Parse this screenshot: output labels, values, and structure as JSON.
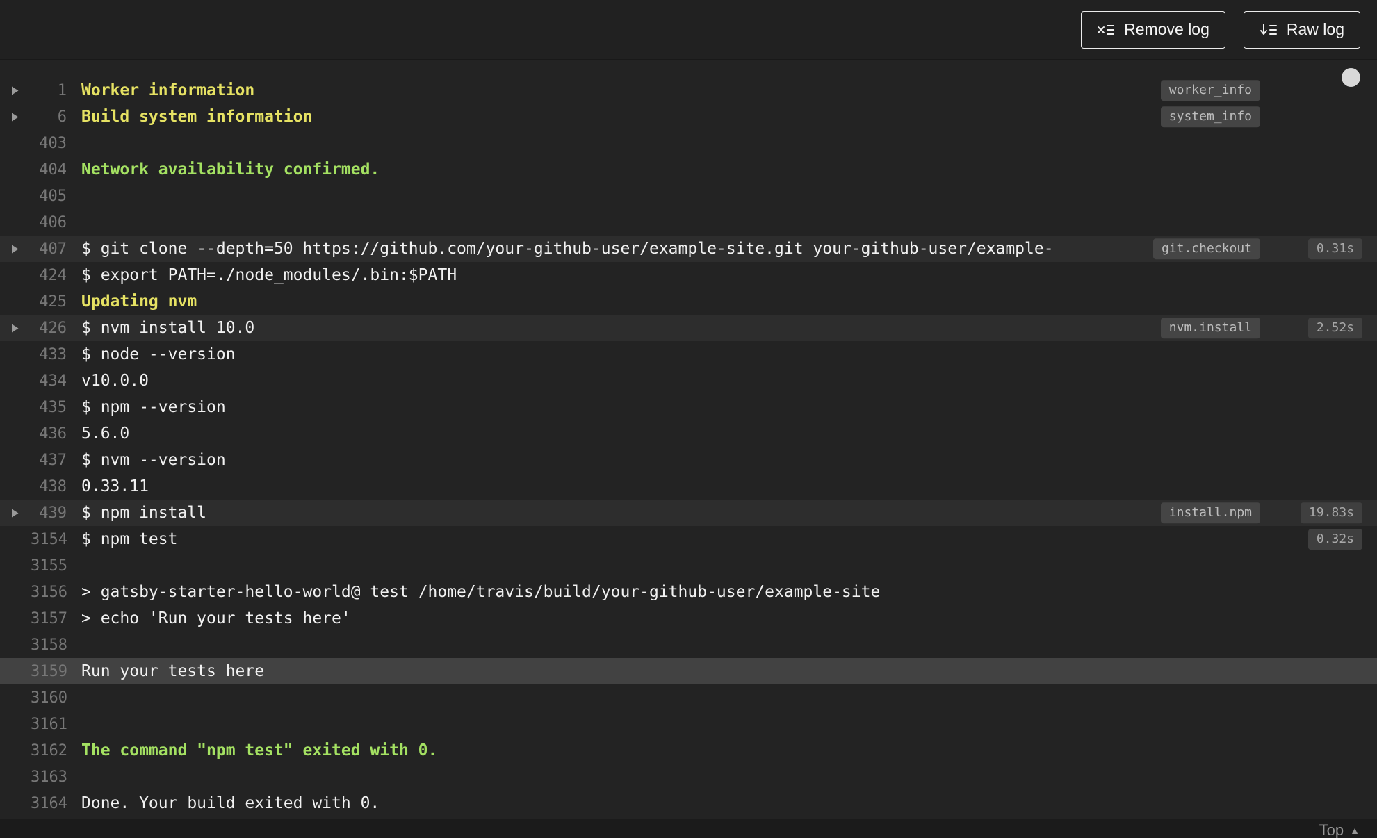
{
  "toolbar": {
    "remove_log": "Remove log",
    "raw_log": "Raw log"
  },
  "footer": {
    "top_label": "Top",
    "caret": "▲"
  },
  "colors": {
    "log_background": "#232323",
    "header_background": "#212121",
    "yellow_text": "#e6e263",
    "green_text": "#a4e162",
    "highlight_row": "#424242",
    "command_row": "#2d2d2d"
  },
  "log": {
    "lines": [
      {
        "num": "1",
        "text": "Worker information",
        "color": "yellow",
        "fold": true,
        "badge": "worker_info"
      },
      {
        "num": "6",
        "text": "Build system information",
        "color": "yellow",
        "fold": true,
        "badge": "system_info"
      },
      {
        "num": "403",
        "text": ""
      },
      {
        "num": "404",
        "text": "Network availability confirmed.",
        "color": "green"
      },
      {
        "num": "405",
        "text": ""
      },
      {
        "num": "406",
        "text": ""
      },
      {
        "num": "407",
        "text": "$ git clone --depth=50 https://github.com/your-github-user/example-site.git your-github-user/example-",
        "fold": true,
        "badge": "git.checkout",
        "time": "0.31s",
        "bg": "command"
      },
      {
        "num": "424",
        "text": "$ export PATH=./node_modules/.bin:$PATH"
      },
      {
        "num": "425",
        "text": "Updating nvm",
        "color": "yellow"
      },
      {
        "num": "426",
        "text": "$ nvm install 10.0",
        "fold": true,
        "badge": "nvm.install",
        "time": "2.52s",
        "bg": "command"
      },
      {
        "num": "433",
        "text": "$ node --version"
      },
      {
        "num": "434",
        "text": "v10.0.0"
      },
      {
        "num": "435",
        "text": "$ npm --version"
      },
      {
        "num": "436",
        "text": "5.6.0"
      },
      {
        "num": "437",
        "text": "$ nvm --version"
      },
      {
        "num": "438",
        "text": "0.33.11"
      },
      {
        "num": "439",
        "text": "$ npm install",
        "fold": true,
        "badge": "install.npm",
        "time": "19.83s",
        "bg": "command"
      },
      {
        "num": "3154",
        "text": "$ npm test",
        "time": "0.32s"
      },
      {
        "num": "3155",
        "text": ""
      },
      {
        "num": "3156",
        "text": "> gatsby-starter-hello-world@ test /home/travis/build/your-github-user/example-site"
      },
      {
        "num": "3157",
        "text": "> echo 'Run your tests here'"
      },
      {
        "num": "3158",
        "text": ""
      },
      {
        "num": "3159",
        "text": "Run your tests here",
        "bg": "highlight"
      },
      {
        "num": "3160",
        "text": ""
      },
      {
        "num": "3161",
        "text": ""
      },
      {
        "num": "3162",
        "text": "The command \"npm test\" exited with 0.",
        "color": "green"
      },
      {
        "num": "3163",
        "text": ""
      },
      {
        "num": "3164",
        "text": "Done. Your build exited with 0."
      }
    ]
  }
}
